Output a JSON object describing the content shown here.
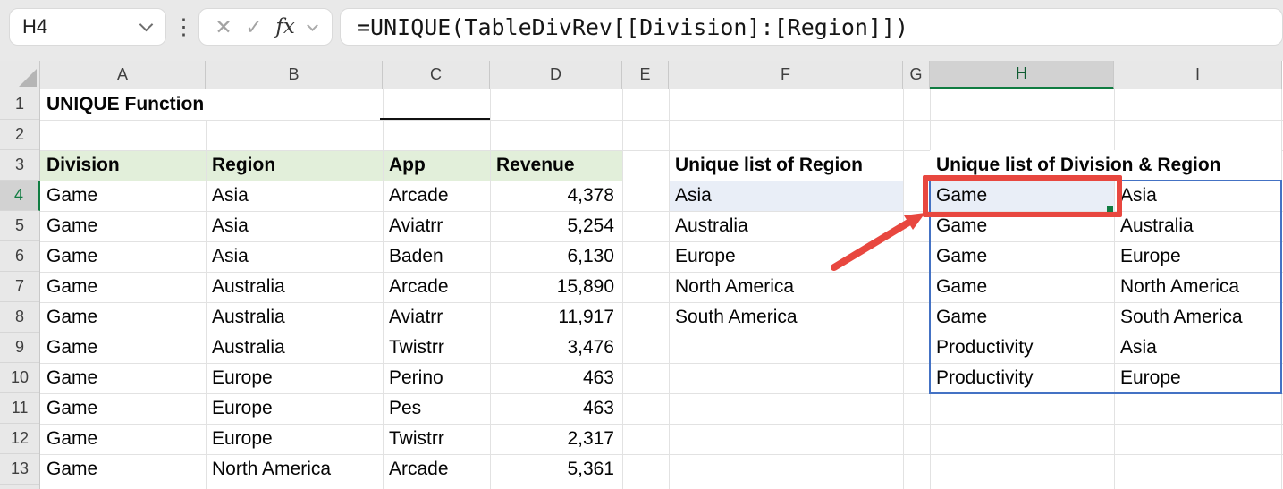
{
  "toolbar": {
    "name_box": "H4",
    "formula": "=UNIQUE(TableDivRev[[Division]:[Region]])",
    "fx_label": "fx",
    "cancel_label": "✕",
    "enter_label": "✓",
    "kebab_label": "⋮"
  },
  "sheet": {
    "selected_cell": "H4",
    "column_headers": [
      "A",
      "B",
      "C",
      "D",
      "E",
      "F",
      "G",
      "H",
      "I"
    ],
    "row_headers": [
      "1",
      "2",
      "3",
      "4",
      "5",
      "6",
      "7",
      "8",
      "9",
      "10",
      "11",
      "12",
      "13"
    ],
    "title_cell": "UNIQUE Function",
    "source_table": {
      "headers": {
        "division": "Division",
        "region": "Region",
        "app": "App",
        "revenue": "Revenue"
      },
      "rows": [
        {
          "division": "Game",
          "region": "Asia",
          "app": "Arcade",
          "revenue": "4,378"
        },
        {
          "division": "Game",
          "region": "Asia",
          "app": "Aviatrr",
          "revenue": "5,254"
        },
        {
          "division": "Game",
          "region": "Asia",
          "app": "Baden",
          "revenue": "6,130"
        },
        {
          "division": "Game",
          "region": "Australia",
          "app": "Arcade",
          "revenue": "15,890"
        },
        {
          "division": "Game",
          "region": "Australia",
          "app": "Aviatrr",
          "revenue": "11,917"
        },
        {
          "division": "Game",
          "region": "Australia",
          "app": "Twistrr",
          "revenue": "3,476"
        },
        {
          "division": "Game",
          "region": "Europe",
          "app": "Perino",
          "revenue": "463"
        },
        {
          "division": "Game",
          "region": "Europe",
          "app": "Pes",
          "revenue": "463"
        },
        {
          "division": "Game",
          "region": "Europe",
          "app": "Twistrr",
          "revenue": "2,317"
        },
        {
          "division": "Game",
          "region": "North America",
          "app": "Arcade",
          "revenue": "5,361"
        }
      ]
    },
    "unique_region": {
      "title": "Unique list of Region",
      "values": [
        "Asia",
        "Australia",
        "Europe",
        "North America",
        "South America"
      ]
    },
    "unique_division_region": {
      "title": "Unique list of Division & Region",
      "rows": [
        {
          "division": "Game",
          "region": "Asia"
        },
        {
          "division": "Game",
          "region": "Australia"
        },
        {
          "division": "Game",
          "region": "Europe"
        },
        {
          "division": "Game",
          "region": "North America"
        },
        {
          "division": "Game",
          "region": "South America"
        },
        {
          "division": "Productivity",
          "region": "Asia"
        },
        {
          "division": "Productivity",
          "region": "Europe"
        }
      ]
    }
  },
  "colors": {
    "header_fill": "#E2EFDA",
    "highlight_fill": "#E9EEF7",
    "spill_border": "#4472C4",
    "annotation_red": "#E8473F",
    "selection_green": "#107C41"
  }
}
